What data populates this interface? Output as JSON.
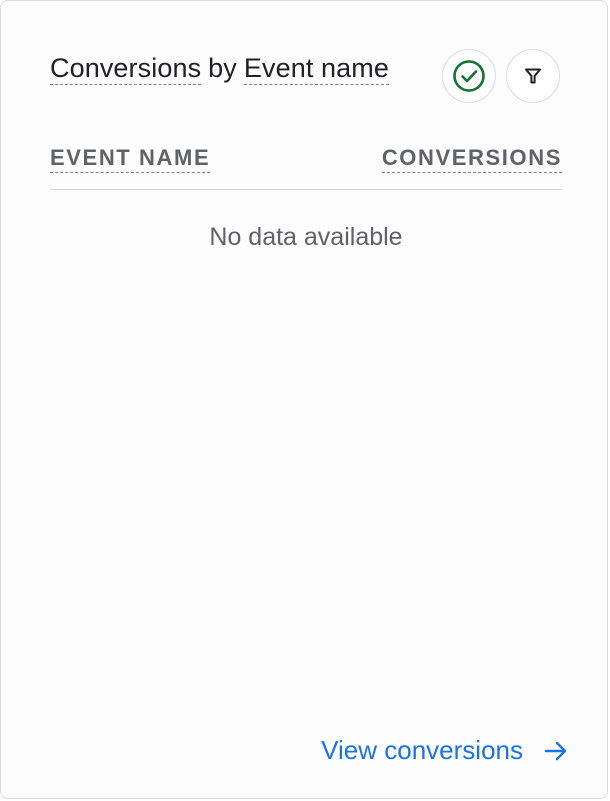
{
  "card": {
    "title_metric": "Conversions",
    "title_joiner": "by",
    "title_dimension": "Event name",
    "check_icon": "check-circle-icon",
    "filter_icon": "filter-icon"
  },
  "table": {
    "columns": [
      "EVENT NAME",
      "CONVERSIONS"
    ],
    "empty_message": "No data available"
  },
  "footer": {
    "link_label": "View conversions",
    "link_icon": "arrow-right-icon"
  },
  "colors": {
    "accent": "#1a73e8",
    "success": "#137333",
    "text_primary": "#202124",
    "text_secondary": "#5f6368",
    "border": "#dadce0"
  }
}
